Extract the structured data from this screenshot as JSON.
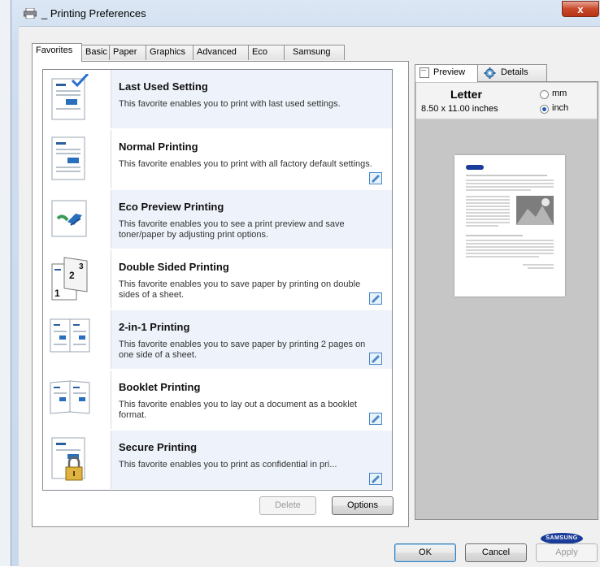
{
  "window": {
    "title": "_ Printing Preferences",
    "close_glyph": "x"
  },
  "tabs": [
    {
      "label": "Favorites",
      "active": true
    },
    {
      "label": "Basic"
    },
    {
      "label": "Paper"
    },
    {
      "label": "Graphics"
    },
    {
      "label": "Advanced"
    },
    {
      "label": "Eco"
    },
    {
      "label": "Samsung"
    }
  ],
  "favorites": [
    {
      "name": "Last Used Setting",
      "desc": "This favorite enables you to print with last used settings.",
      "icon": "last-used-icon",
      "editable": false
    },
    {
      "name": "Normal Printing",
      "desc": "This favorite enables you to print with all factory default settings.",
      "icon": "normal-printing-icon",
      "editable": true
    },
    {
      "name": "Eco Preview Printing",
      "desc": "This favorite enables you to see a print preview and save toner/paper by adjusting print options.",
      "icon": "eco-preview-icon",
      "editable": false
    },
    {
      "name": "Double Sided Printing",
      "desc": "This favorite enables you to save paper by printing on double sides of a sheet.",
      "icon": "double-sided-icon",
      "editable": true
    },
    {
      "name": "2-in-1 Printing",
      "desc": "This favorite enables you to save paper by printing 2 pages on one side of a sheet.",
      "icon": "two-in-one-icon",
      "editable": true
    },
    {
      "name": "Booklet Printing",
      "desc": "This favorite enables you to lay out a document as a booklet format.",
      "icon": "booklet-icon",
      "editable": true
    },
    {
      "name": "Secure Printing",
      "desc": "This favorite enables you to print as confidential in pri...",
      "icon": "secure-printing-icon",
      "editable": true
    }
  ],
  "list_buttons": {
    "delete": "Delete",
    "options": "Options"
  },
  "preview_tabs": [
    {
      "label": "Preview",
      "active": true
    },
    {
      "label": "Details"
    }
  ],
  "paper": {
    "name": "Letter",
    "size": "8.50 x 11.00 inches",
    "units": [
      {
        "label": "mm",
        "selected": false
      },
      {
        "label": "inch",
        "selected": true
      }
    ]
  },
  "brand": "SAMSUNG",
  "dialog_buttons": {
    "ok": "OK",
    "cancel": "Cancel",
    "apply": "Apply"
  },
  "colors": {
    "accent": "#1e5bb6",
    "selected_row": "#eef3fb",
    "brand": "#1a3d9a"
  }
}
